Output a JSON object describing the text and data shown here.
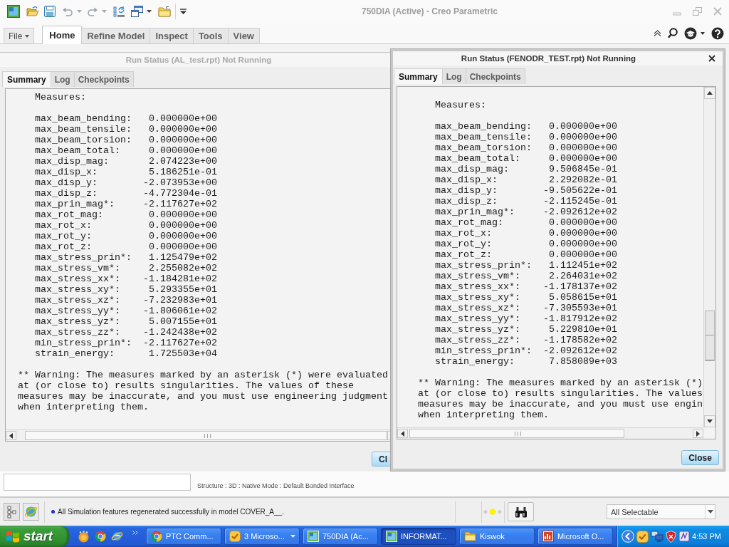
{
  "window": {
    "title": "750DIA (Active) - Creo Parametric"
  },
  "ribbon": {
    "tabs": [
      {
        "label": "File",
        "kind": "menu",
        "selected": false
      },
      {
        "label": "Home",
        "kind": "tab",
        "selected": true
      },
      {
        "label": "Refine Model",
        "kind": "tab",
        "selected": false
      },
      {
        "label": "Inspect",
        "kind": "tab",
        "selected": false
      },
      {
        "label": "Tools",
        "kind": "tab",
        "selected": false
      },
      {
        "label": "View",
        "kind": "tab",
        "selected": false
      }
    ]
  },
  "dialogs": [
    {
      "title": "Run Status (AL_test.rpt) Not Running",
      "active": false,
      "tabs": [
        {
          "label": "Summary",
          "selected": true
        },
        {
          "label": "Log",
          "selected": false
        },
        {
          "label": "Checkpoints",
          "selected": false
        }
      ],
      "report": {
        "heading": "Measures:",
        "measures": [
          {
            "name": "max_beam_bending:",
            "value": "0.000000e+00"
          },
          {
            "name": "max_beam_tensile:",
            "value": "0.000000e+00"
          },
          {
            "name": "max_beam_torsion:",
            "value": "0.000000e+00"
          },
          {
            "name": "max_beam_total:",
            "value": "0.000000e+00"
          },
          {
            "name": "max_disp_mag:",
            "value": "2.074223e+00"
          },
          {
            "name": "max_disp_x:",
            "value": "5.186251e-01"
          },
          {
            "name": "max_disp_y:",
            "value": "-2.073953e+00"
          },
          {
            "name": "max_disp_z:",
            "value": "-4.772304e-01"
          },
          {
            "name": "max_prin_mag*:",
            "value": "-2.117627e+02"
          },
          {
            "name": "max_rot_mag:",
            "value": "0.000000e+00"
          },
          {
            "name": "max_rot_x:",
            "value": "0.000000e+00"
          },
          {
            "name": "max_rot_y:",
            "value": "0.000000e+00"
          },
          {
            "name": "max_rot_z:",
            "value": "0.000000e+00"
          },
          {
            "name": "max_stress_prin*:",
            "value": "1.125479e+02"
          },
          {
            "name": "max_stress_vm*:",
            "value": "2.255082e+02"
          },
          {
            "name": "max_stress_xx*:",
            "value": "-1.184281e+02"
          },
          {
            "name": "max_stress_xy*:",
            "value": "5.293355e+01"
          },
          {
            "name": "max_stress_xz*:",
            "value": "-7.232983e+01"
          },
          {
            "name": "max_stress_yy*:",
            "value": "-1.806061e+02"
          },
          {
            "name": "max_stress_yz*:",
            "value": "5.007155e+01"
          },
          {
            "name": "max_stress_zz*:",
            "value": "-1.242438e+02"
          },
          {
            "name": "min_stress_prin*:",
            "value": "-2.117627e+02"
          },
          {
            "name": "strain_energy:",
            "value": "1.725503e+04"
          }
        ],
        "warning": "** Warning: The measures marked by an asterisk (*) were evaluated\nat (or close to) results singularities. The values of these\nmeasures may be inaccurate, and you must use engineering judgment\nwhen interpreting them."
      },
      "button": "Cl"
    },
    {
      "title": "Run Status (FENODR_TEST.rpt) Not Running",
      "active": true,
      "tabs": [
        {
          "label": "Summary",
          "selected": true
        },
        {
          "label": "Log",
          "selected": false
        },
        {
          "label": "Checkpoints",
          "selected": false
        }
      ],
      "report": {
        "heading": "Measures:",
        "measures": [
          {
            "name": "max_beam_bending:",
            "value": "0.000000e+00"
          },
          {
            "name": "max_beam_tensile:",
            "value": "0.000000e+00"
          },
          {
            "name": "max_beam_torsion:",
            "value": "0.000000e+00"
          },
          {
            "name": "max_beam_total:",
            "value": "0.000000e+00"
          },
          {
            "name": "max_disp_mag:",
            "value": "9.506845e-01"
          },
          {
            "name": "max_disp_x:",
            "value": "2.292082e-01"
          },
          {
            "name": "max_disp_y:",
            "value": "-9.505622e-01"
          },
          {
            "name": "max_disp_z:",
            "value": "-2.115245e-01"
          },
          {
            "name": "max_prin_mag*:",
            "value": "-2.092612e+02"
          },
          {
            "name": "max_rot_mag:",
            "value": "0.000000e+00"
          },
          {
            "name": "max_rot_x:",
            "value": "0.000000e+00"
          },
          {
            "name": "max_rot_y:",
            "value": "0.000000e+00"
          },
          {
            "name": "max_rot_z:",
            "value": "0.000000e+00"
          },
          {
            "name": "max_stress_prin*:",
            "value": "1.112451e+02"
          },
          {
            "name": "max_stress_vm*:",
            "value": "2.264031e+02"
          },
          {
            "name": "max_stress_xx*:",
            "value": "-1.178137e+02"
          },
          {
            "name": "max_stress_xy*:",
            "value": "5.058615e+01"
          },
          {
            "name": "max_stress_xz*:",
            "value": "-7.305593e+01"
          },
          {
            "name": "max_stress_yy*:",
            "value": "-1.817912e+02"
          },
          {
            "name": "max_stress_yz*:",
            "value": "5.229810e+01"
          },
          {
            "name": "max_stress_zz*:",
            "value": "-1.178582e+02"
          },
          {
            "name": "min_stress_prin*:",
            "value": "-2.092612e+02"
          },
          {
            "name": "strain_energy:",
            "value": "7.858089e+03"
          }
        ],
        "warning": "** Warning: The measures marked by an asterisk (*)\nat (or close to) results singularities. The values\nmeasures may be inaccurate, and you must use engin\nwhen interpreting them."
      },
      "button": "Close"
    }
  ],
  "mode_line": "Structure : 3D : Native Mode : Default Bonded Interface",
  "status_bar": {
    "message": "All Simulation features regenerated successfully in model COVER_A__.",
    "selection_filter": "All Selectable"
  },
  "taskbar": {
    "start": "start",
    "tasks": [
      {
        "label": "PTC Comm...",
        "selected": false,
        "grouped": false
      },
      {
        "label": "3 Microso...",
        "selected": false,
        "grouped": true
      },
      {
        "label": "750DIA (Ac...",
        "selected": false,
        "grouped": false
      },
      {
        "label": "INFORMAT...",
        "selected": true,
        "grouped": false
      },
      {
        "label": "Kiswok",
        "selected": false,
        "grouped": false
      },
      {
        "label": "Microsoft O...",
        "selected": false,
        "grouped": false
      }
    ],
    "clock": "4:53 PM"
  }
}
